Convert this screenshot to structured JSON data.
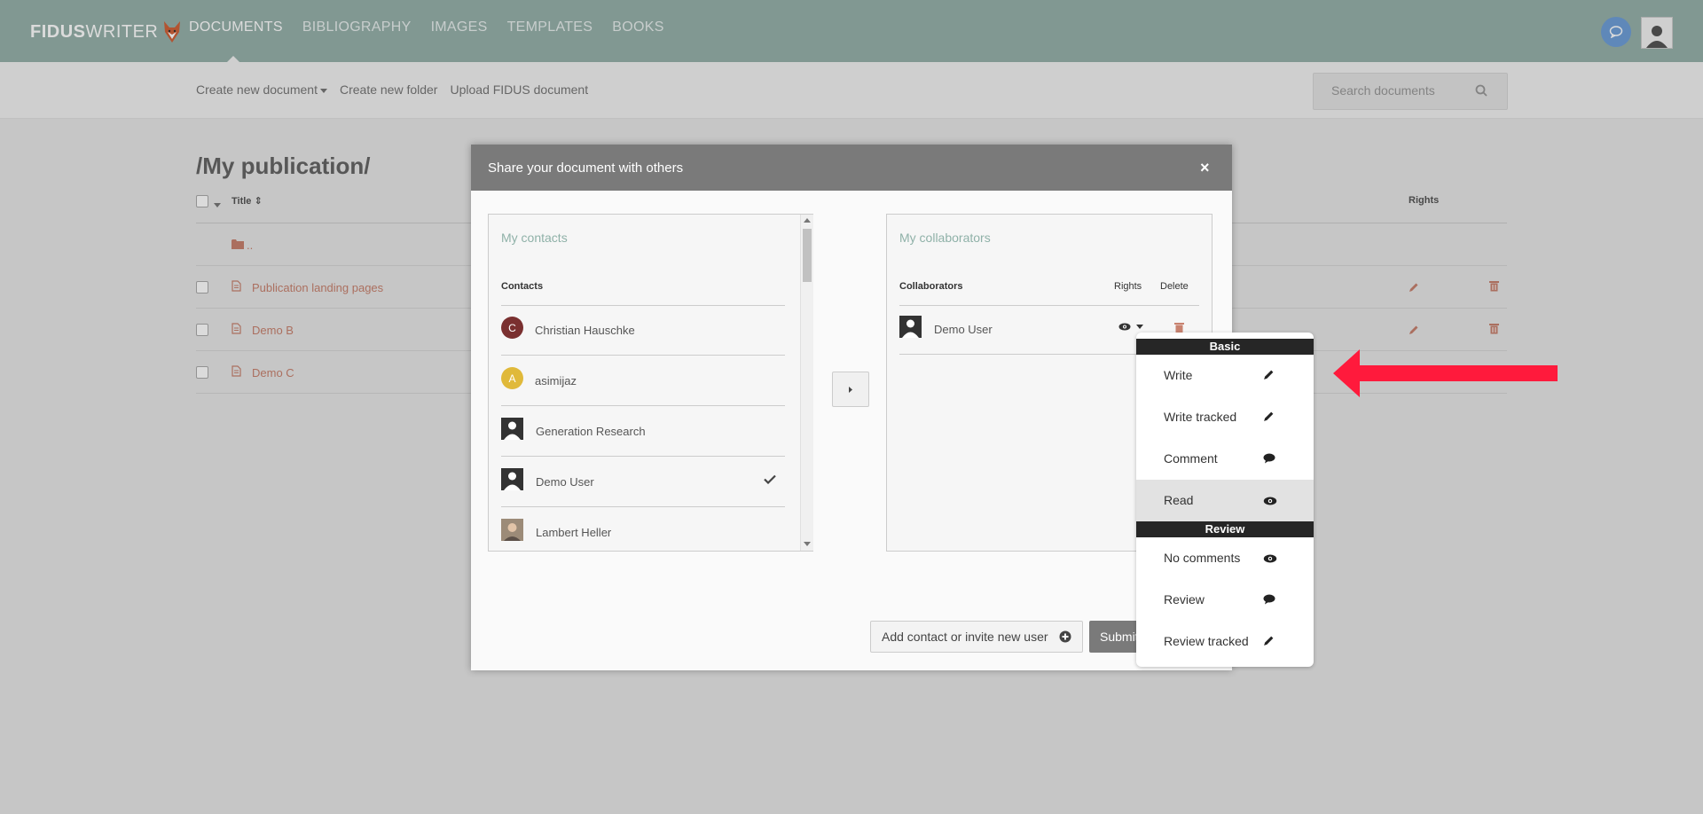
{
  "app": {
    "logo_bold": "FIDUS",
    "logo_light": "WRITER",
    "nav": [
      {
        "label": "DOCUMENTS",
        "active": true
      },
      {
        "label": "BIBLIOGRAPHY",
        "active": false
      },
      {
        "label": "IMAGES",
        "active": false
      },
      {
        "label": "TEMPLATES",
        "active": false
      },
      {
        "label": "BOOKS",
        "active": false
      }
    ],
    "chat_icon": "chat-bubble-icon",
    "user_icon": "user-avatar-icon"
  },
  "toolbar": {
    "create_document": "Create new document",
    "create_folder": "Create new folder",
    "upload": "Upload FIDUS document",
    "search_placeholder": "Search documents"
  },
  "documents": {
    "folder_title": "/My publication/",
    "col_title": "Title",
    "col_rights": "Rights",
    "parent_folder": "..",
    "rows": [
      {
        "name": "Publication landing pages"
      },
      {
        "name": "Demo B"
      },
      {
        "name": "Demo C"
      }
    ]
  },
  "modal": {
    "title": "Share your document with others",
    "close": "×",
    "contacts": {
      "title": "My contacts",
      "header": "Contacts",
      "items": [
        {
          "name": "Christian Hauschke",
          "initial": "C",
          "avatar_color": "#7a3030",
          "avatar": "letter",
          "selected": false
        },
        {
          "name": "asimijaz",
          "initial": "A",
          "avatar_color": "#e0b93a",
          "avatar": "letter",
          "selected": false
        },
        {
          "name": "Generation Research",
          "initial": "",
          "avatar": "default",
          "selected": false
        },
        {
          "name": "Demo User",
          "initial": "",
          "avatar": "default",
          "selected": true
        },
        {
          "name": "Lambert Heller",
          "initial": "",
          "avatar": "photo",
          "selected": false
        }
      ]
    },
    "collaborators": {
      "title": "My collaborators",
      "col_collaborators": "Collaborators",
      "col_rights": "Rights",
      "col_delete": "Delete",
      "items": [
        {
          "name": "Demo User",
          "rights_icon": "eye-icon"
        }
      ]
    },
    "add_contact_button": "Add contact or invite new user",
    "submit_button": "Submit"
  },
  "rights_menu": {
    "basic_header": "Basic",
    "review_header": "Review",
    "basic": [
      {
        "label": "Write",
        "icon": "pencil-icon",
        "selected": false
      },
      {
        "label": "Write tracked",
        "icon": "pencil-icon",
        "selected": false
      },
      {
        "label": "Comment",
        "icon": "comment-icon",
        "selected": false
      },
      {
        "label": "Read",
        "icon": "eye-icon",
        "selected": true
      }
    ],
    "review": [
      {
        "label": "No comments",
        "icon": "eye-icon",
        "selected": false
      },
      {
        "label": "Review",
        "icon": "comment-icon",
        "selected": false
      },
      {
        "label": "Review tracked",
        "icon": "pencil-icon",
        "selected": false
      }
    ]
  },
  "colors": {
    "header_bg": "#97b1ab",
    "accent_green": "#8fb1a8",
    "doc_link": "#c8826f",
    "modal_header": "#7a7a7a",
    "annotation_arrow": "#ff1a3c"
  }
}
